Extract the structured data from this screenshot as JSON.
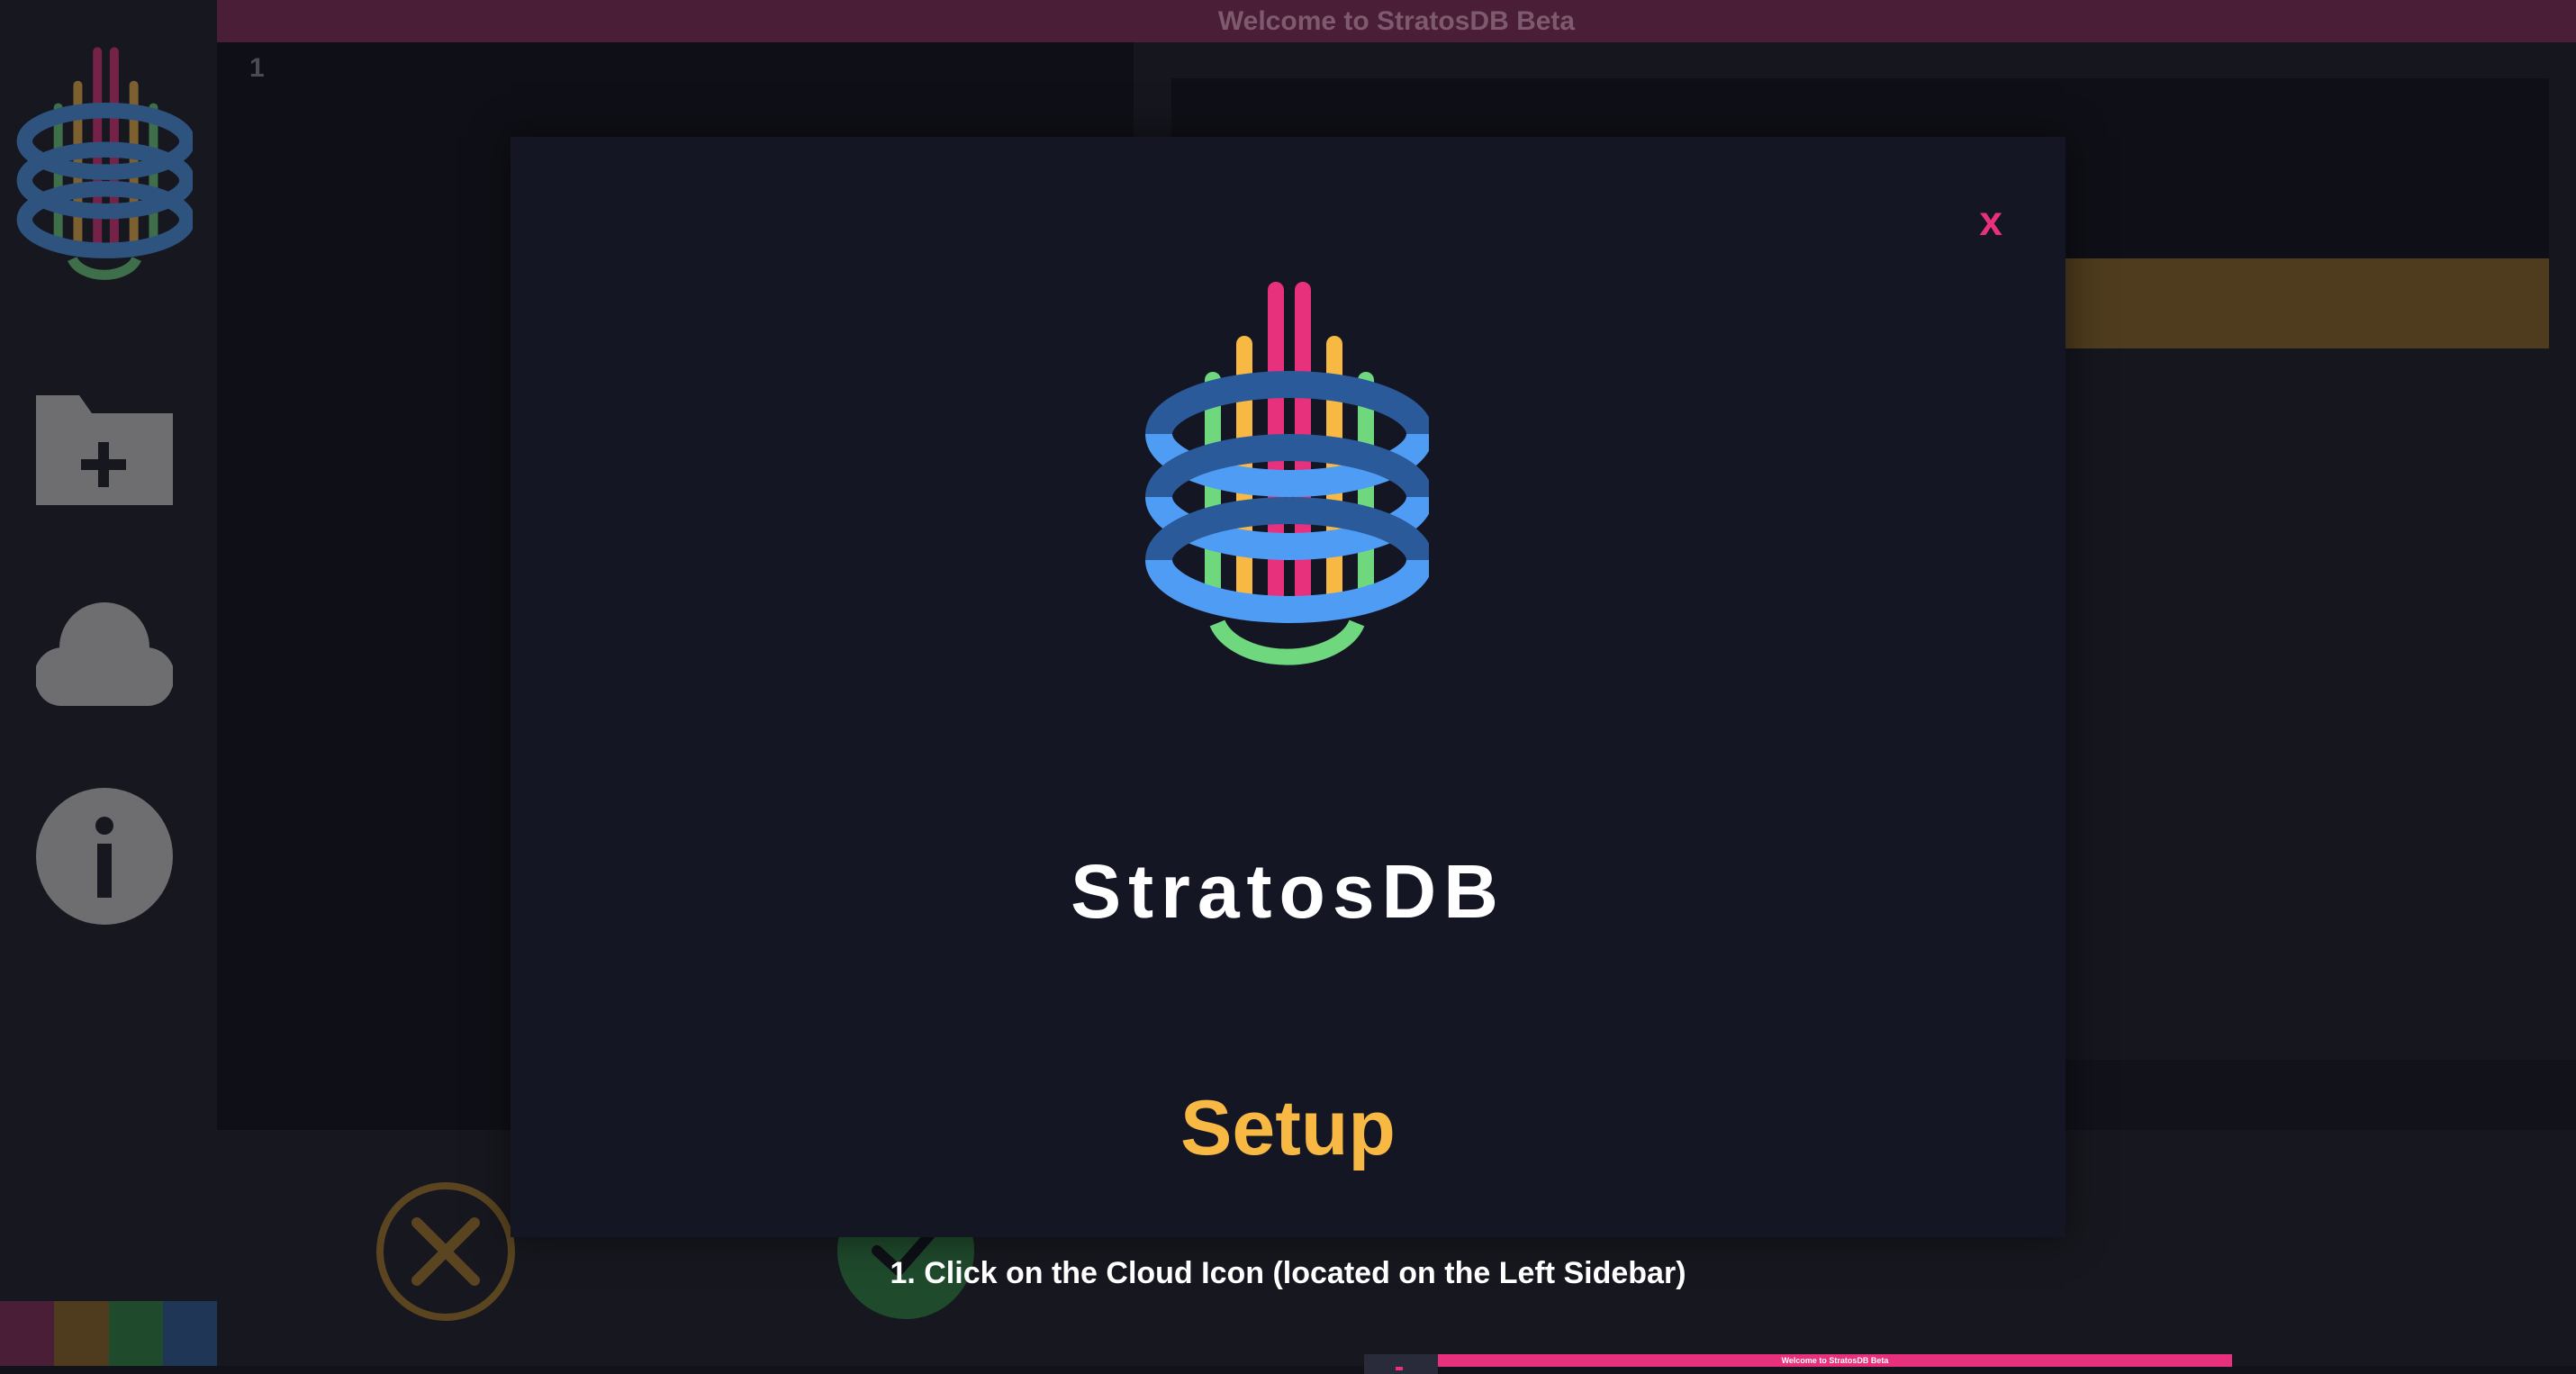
{
  "app": {
    "window_title": "Welcome to StratosDB Beta"
  },
  "sidebar": {
    "items": [
      {
        "name": "new-folder",
        "icon": "folder-plus-icon"
      },
      {
        "name": "cloud",
        "icon": "cloud-icon"
      },
      {
        "name": "info",
        "icon": "info-icon"
      }
    ],
    "swatches": [
      "#4a1e36",
      "#4f3c1e",
      "#1f4a2c",
      "#1f3656"
    ]
  },
  "editor": {
    "line_number": "1"
  },
  "modal": {
    "close_label": "x",
    "brand_name": "StratosDB",
    "setup_title": "Setup",
    "instruction": "1. Click on the Cloud Icon (located on the Left Sidebar)",
    "preview_title": "Welcome to StratosDB Beta"
  },
  "colors": {
    "accent_pink": "#e8317c",
    "accent_yellow": "#f8b944",
    "accent_green": "#6fd87f",
    "accent_blue": "#4f9cf5",
    "modal_bg": "#151624"
  }
}
